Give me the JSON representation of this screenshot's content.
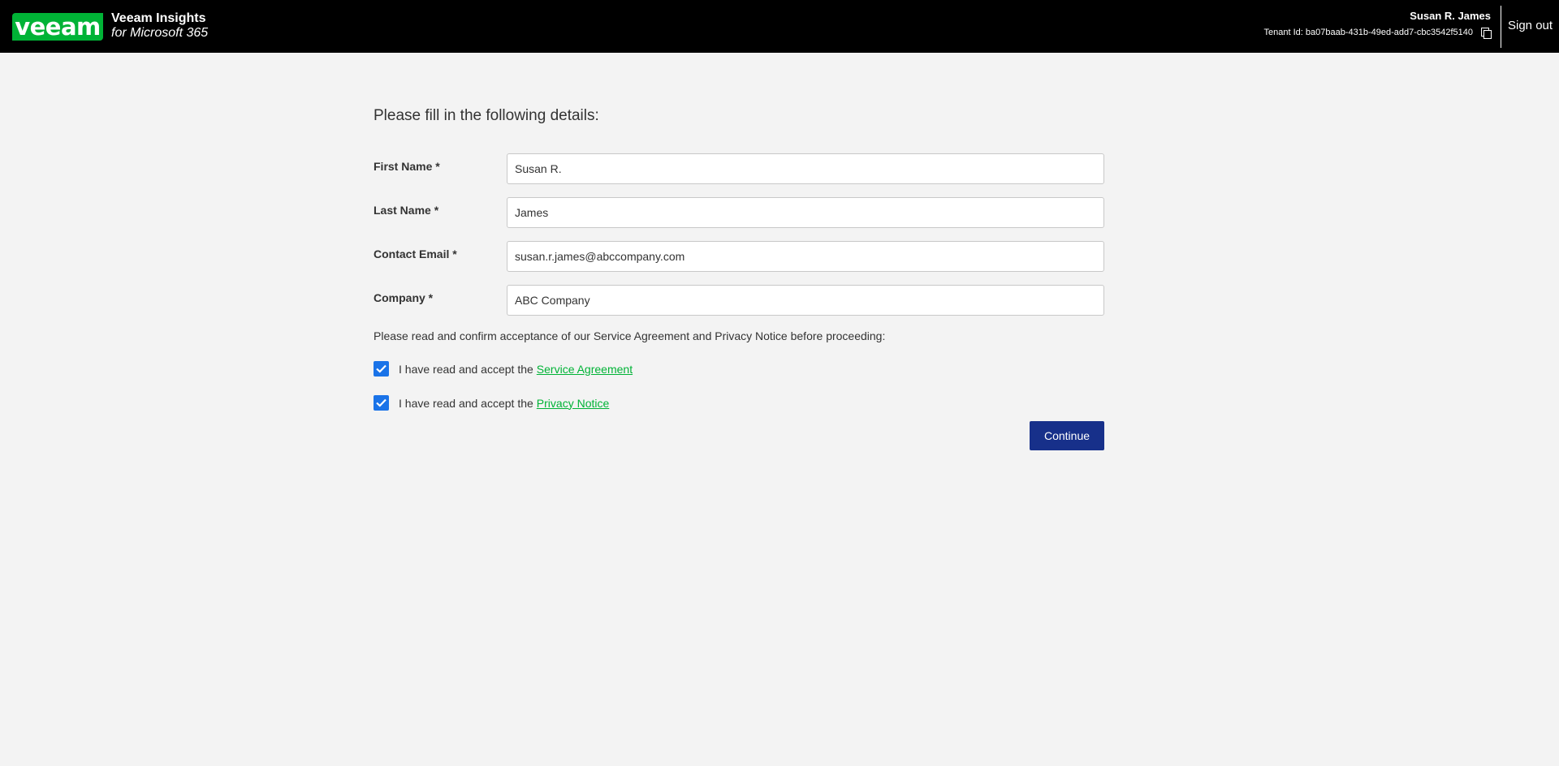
{
  "header": {
    "logo_text": "veeam",
    "product_name": "Veeam Insights",
    "product_sub": "for Microsoft 365",
    "user_name": "Susan R. James",
    "tenant_id": "Tenant Id: ba07baab-431b-49ed-add7-cbc3542f5140",
    "signout_label": "Sign out",
    "copy_icon": "copy-icon"
  },
  "form": {
    "title": "Please fill in the following details:",
    "fields": [
      {
        "label": "First Name *",
        "value": "Susan R."
      },
      {
        "label": "Last Name *",
        "value": "James"
      },
      {
        "label": "Contact Email *",
        "value": "susan.r.james@abccompany.com"
      },
      {
        "label": "Company *",
        "value": "ABC Company"
      }
    ],
    "consent_text": "Please read and confirm acceptance of our Service Agreement and Privacy Notice before proceeding:",
    "checks": [
      {
        "label": "I have read and accept the",
        "link": "Service Agreement",
        "checked": true
      },
      {
        "label": "I have read and accept the",
        "link": "Privacy Notice",
        "checked": true
      }
    ],
    "continue_label": "Continue"
  },
  "colors": {
    "brand_green": "#00b336",
    "button_navy": "#17308a",
    "checkbox_blue": "#1a73e8",
    "header_bg": "#000000",
    "page_bg": "#f3f3f3"
  }
}
